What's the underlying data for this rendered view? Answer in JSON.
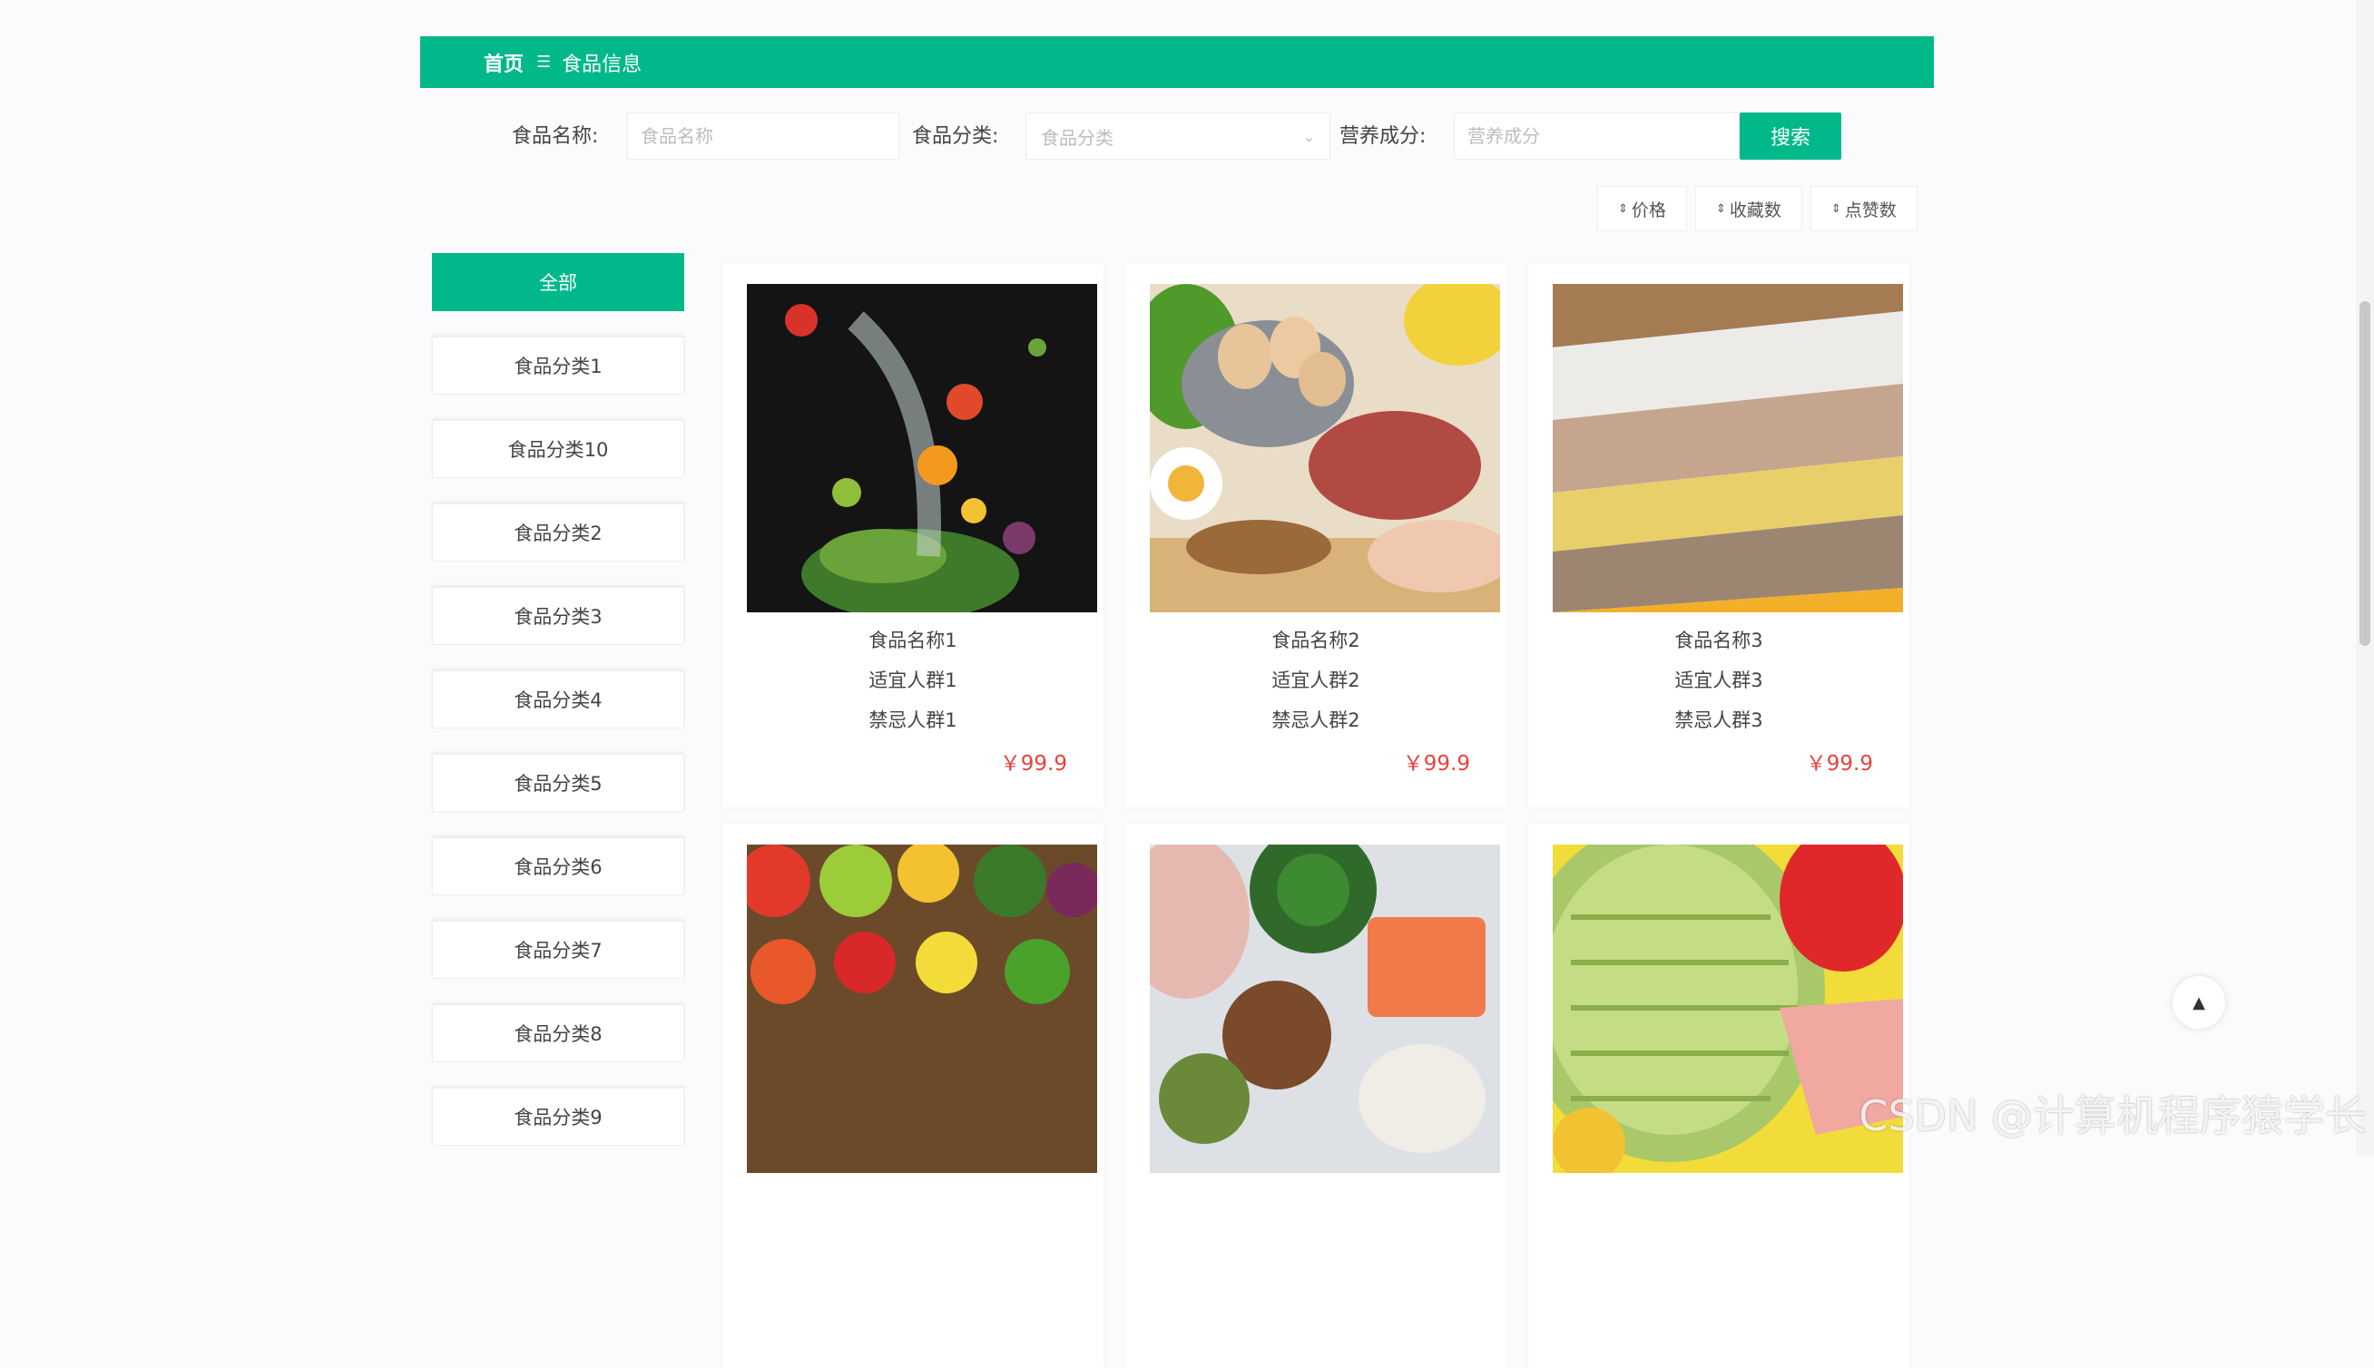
{
  "breadcrumb": {
    "home": "首页",
    "separator": "☰",
    "current": "食品信息"
  },
  "search": {
    "name_label": "食品名称:",
    "name_placeholder": "食品名称",
    "category_label": "食品分类:",
    "category_placeholder": "食品分类",
    "nutrition_label": "营养成分:",
    "nutrition_placeholder": "营养成分",
    "button": "搜索"
  },
  "sort": [
    {
      "label": "价格",
      "icon": "sort-arrows-icon"
    },
    {
      "label": "收藏数",
      "icon": "sort-arrows-icon"
    },
    {
      "label": "点赞数",
      "icon": "sort-arrows-icon"
    }
  ],
  "categories": [
    "全部",
    "食品分类1",
    "食品分类10",
    "食品分类2",
    "食品分类3",
    "食品分类4",
    "食品分类5",
    "食品分类6",
    "食品分类7",
    "食品分类8",
    "食品分类9"
  ],
  "products": [
    {
      "name": "食品名称1",
      "fit": "适宜人群1",
      "avoid": "禁忌人群1",
      "price": "￥99.9",
      "image": "salad-splash"
    },
    {
      "name": "食品名称2",
      "fit": "适宜人群2",
      "avoid": "禁忌人群2",
      "price": "￥99.9",
      "image": "eggs-meat"
    },
    {
      "name": "食品名称3",
      "fit": "适宜人群3",
      "avoid": "禁忌人群3",
      "price": "￥99.9",
      "image": "grains"
    },
    {
      "name": "",
      "fit": "",
      "avoid": "",
      "price": "",
      "image": "vegetables"
    },
    {
      "name": "",
      "fit": "",
      "avoid": "",
      "price": "",
      "image": "protein-spread"
    },
    {
      "name": "",
      "fit": "",
      "avoid": "",
      "price": "",
      "image": "fruit-avocado"
    }
  ],
  "back_to_top": "▲",
  "watermark": "CSDN @计算机程序猿学长",
  "colors": {
    "accent": "#00b88a",
    "price": "#e64340"
  }
}
